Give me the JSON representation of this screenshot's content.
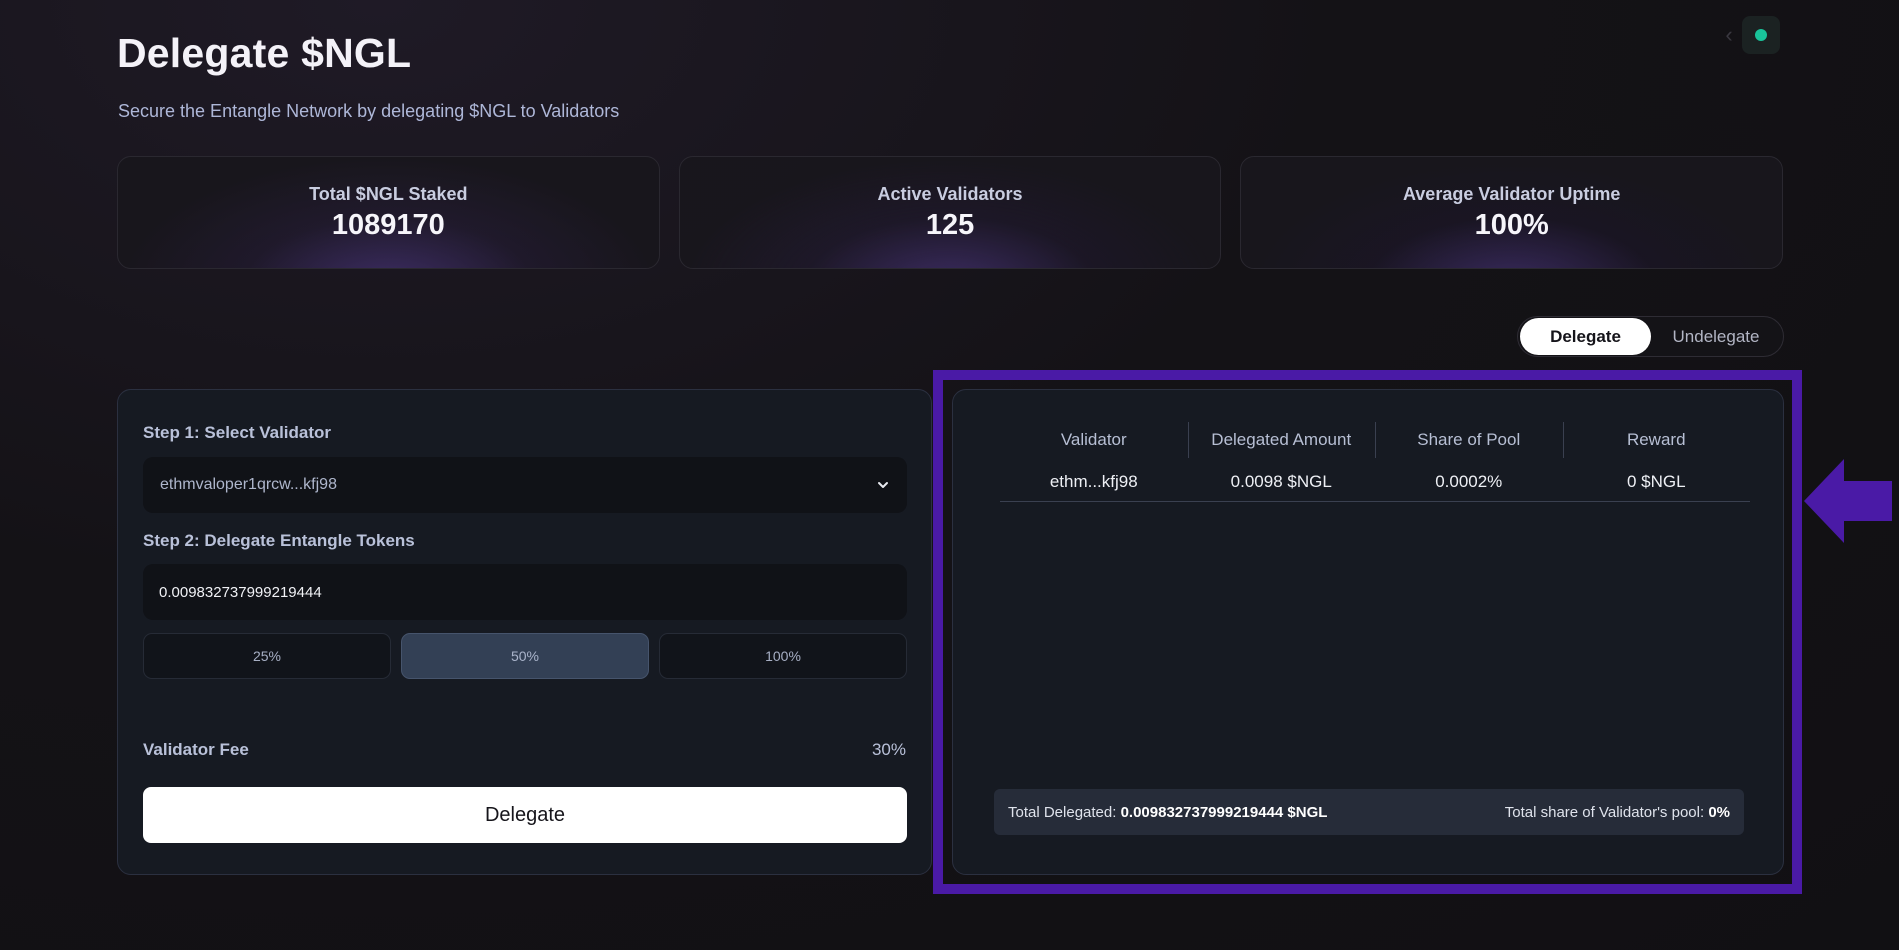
{
  "header": {
    "title": "Delegate $NGL",
    "subtitle": "Secure the Entangle Network by delegating $NGL to Validators"
  },
  "top_right": {
    "icons": [
      "chevron-left-icon",
      "status-dot-icon"
    ],
    "status_color": "#19c39a"
  },
  "stats": [
    {
      "label": "Total $NGL Staked",
      "value": "1089170"
    },
    {
      "label": "Active Validators",
      "value": "125"
    },
    {
      "label": "Average Validator Uptime",
      "value": "100%"
    }
  ],
  "mode_toggle": {
    "active": "Delegate",
    "inactive": "Undelegate"
  },
  "form": {
    "step1_label": "Step 1: Select Validator",
    "selected_validator": "ethmvaloper1qrcw...kfj98",
    "step2_label": "Step 2: Delegate Entangle Tokens",
    "amount_value": "0.009832737999219444",
    "percent_options": [
      "25%",
      "50%",
      "100%"
    ],
    "selected_percent": "50%",
    "fee_label": "Validator Fee",
    "fee_value": "30%",
    "delegate_button": "Delegate"
  },
  "table": {
    "headers": [
      "Validator",
      "Delegated Amount",
      "Share of Pool",
      "Reward"
    ],
    "rows": [
      [
        "ethm...kfj98",
        "0.0098 $NGL",
        "0.0002%",
        "0 $NGL"
      ]
    ],
    "footer": {
      "total_delegated_label": "Total Delegated:",
      "total_delegated_value": "0.009832737999219444 $NGL",
      "share_label": "Total share of Validator's pool:",
      "share_value": "0%"
    }
  },
  "colors": {
    "highlight": "#4a1aa6",
    "primary_button": "#ffffff",
    "panel_bg": "#161a22"
  }
}
